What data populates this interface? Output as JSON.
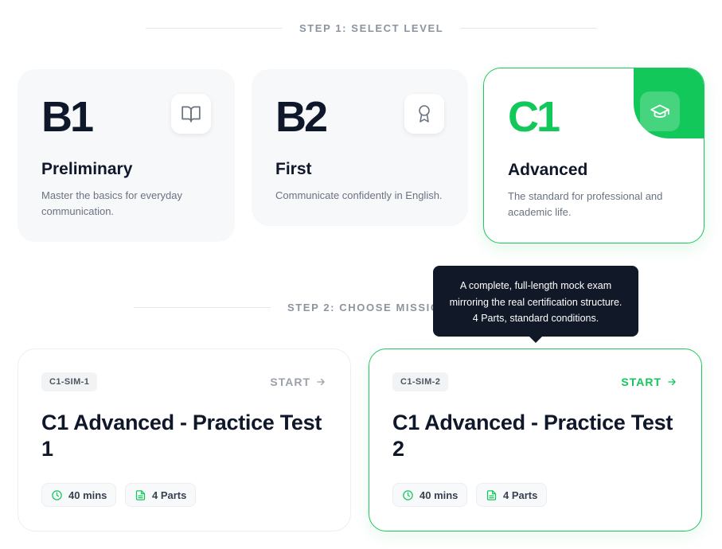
{
  "step1": {
    "label": "STEP 1: SELECT LEVEL"
  },
  "levels": [
    {
      "code": "B1",
      "title": "Preliminary",
      "description": "Master the basics for everyday communication.",
      "icon": "book-icon",
      "selected": false
    },
    {
      "code": "B2",
      "title": "First",
      "description": "Communicate confidently in English.",
      "icon": "award-icon",
      "selected": false
    },
    {
      "code": "C1",
      "title": "Advanced",
      "description": "The standard for professional and academic life.",
      "icon": "graduation-cap-icon",
      "selected": true
    }
  ],
  "step2": {
    "label": "STEP 2: CHOOSE MISSION"
  },
  "tooltip": {
    "line1": "A complete, full-length mock exam",
    "line2": "mirroring the real certification structure.",
    "line3": "4 Parts, standard conditions."
  },
  "missions": [
    {
      "id": "C1-SIM-1",
      "title": "C1 Advanced - Practice Test 1",
      "start_label": "START",
      "duration": "40 mins",
      "parts": "4 Parts",
      "active": false
    },
    {
      "id": "C1-SIM-2",
      "title": "C1 Advanced - Practice Test 2",
      "start_label": "START",
      "duration": "40 mins",
      "parts": "4 Parts",
      "active": true
    }
  ],
  "colors": {
    "accent": "#12c85a",
    "dark": "#0f172a",
    "muted": "#6b7280"
  }
}
